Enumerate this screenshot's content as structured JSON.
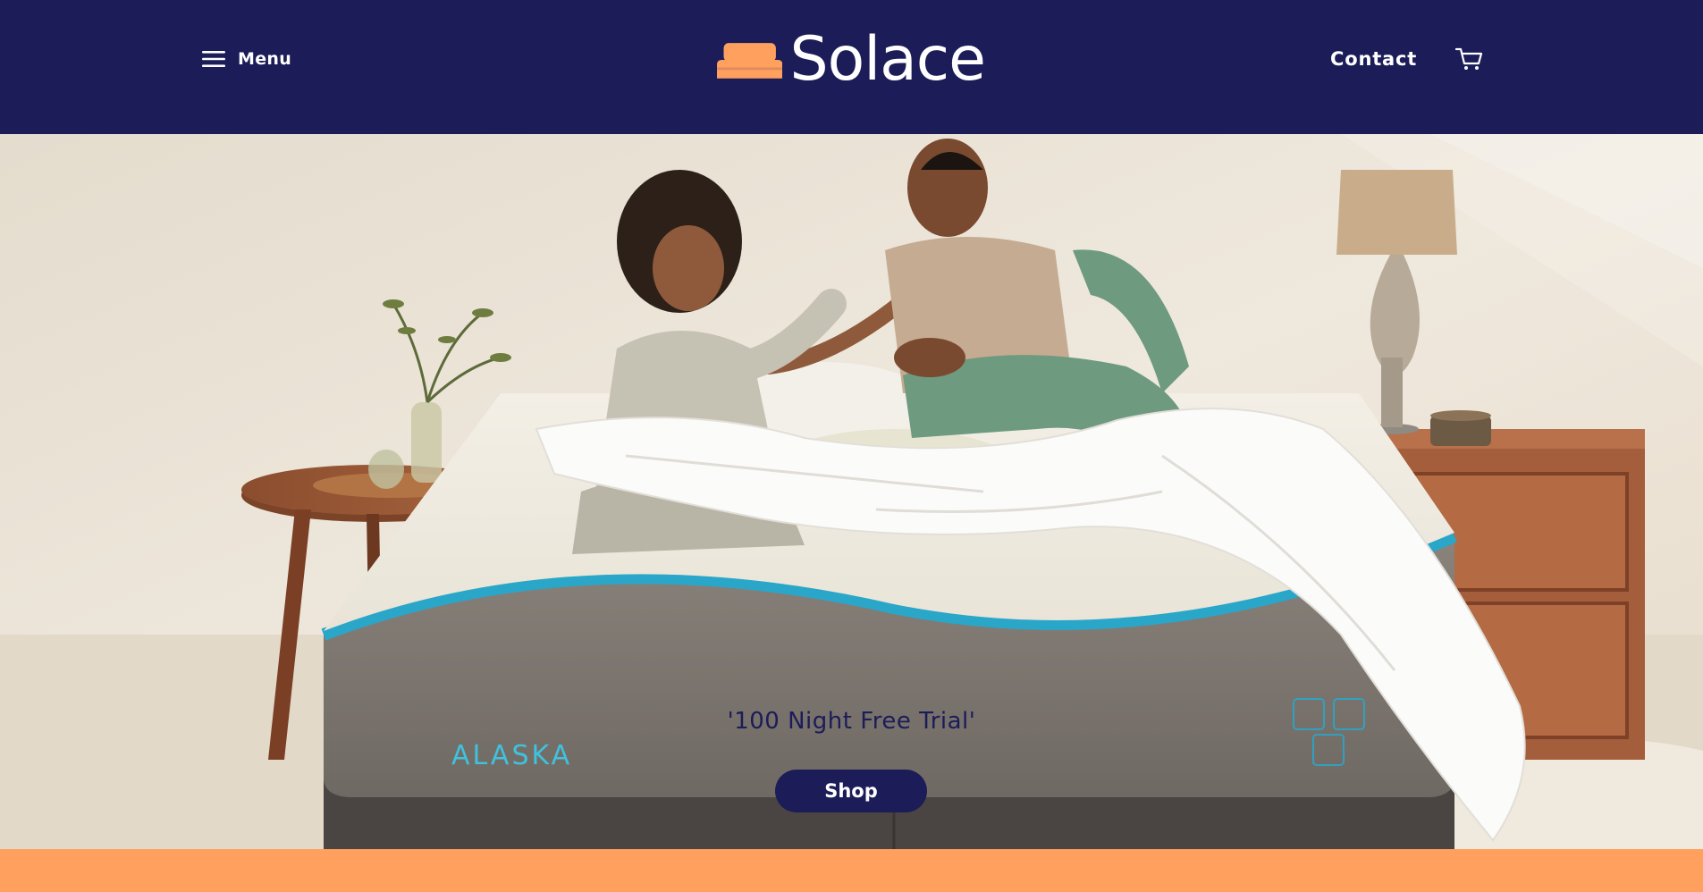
{
  "header": {
    "menu_label": "Menu",
    "logo_text": "Solace",
    "contact_label": "Contact",
    "icons": {
      "menu": "hamburger-icon",
      "logo": "bed-logo-icon",
      "cart": "cart-icon"
    }
  },
  "hero": {
    "tagline": "'100 Night Free Trial'",
    "mattress_brand": "ALASKA",
    "shop_label": "Shop"
  },
  "colors": {
    "brand_navy": "#1c1c59",
    "brand_orange": "#ffa05e",
    "accent_teal": "#2aa6c9",
    "white": "#ffffff"
  }
}
